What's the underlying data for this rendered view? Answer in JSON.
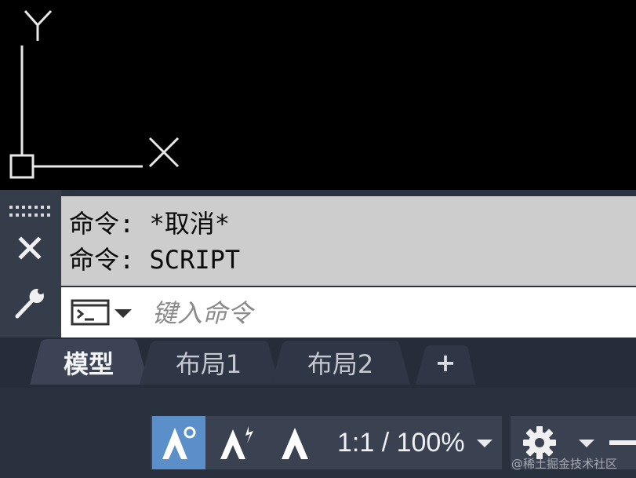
{
  "command_window": {
    "history": [
      "命令: *取消*",
      "命令: SCRIPT"
    ],
    "input_placeholder": "键入命令"
  },
  "layout_tabs": [
    {
      "label": "模型",
      "active": true
    },
    {
      "label": "布局1",
      "active": false
    },
    {
      "label": "布局2",
      "active": false
    }
  ],
  "add_tab_label": "+",
  "status_bar": {
    "annotation_scale": "1:1 / 100%"
  },
  "ucs_labels": {
    "y": "Y",
    "x": "X"
  },
  "watermark": "@稀土掘金技术社区",
  "icons": [
    "ucs-icon",
    "grip-icon",
    "close-icon",
    "wrench-icon",
    "terminal-icon",
    "chevron-down-icon",
    "plus-icon",
    "annotation-visibility-icon",
    "auto-scale-icon",
    "annotation-scale-icon",
    "gear-icon",
    "minus-icon"
  ],
  "colors": {
    "canvas": "#000000",
    "panel": "#353c4a",
    "history_bg": "#cdcdcd",
    "tab_bar": "#262d3a",
    "active_toggle": "#5b8fc9"
  }
}
